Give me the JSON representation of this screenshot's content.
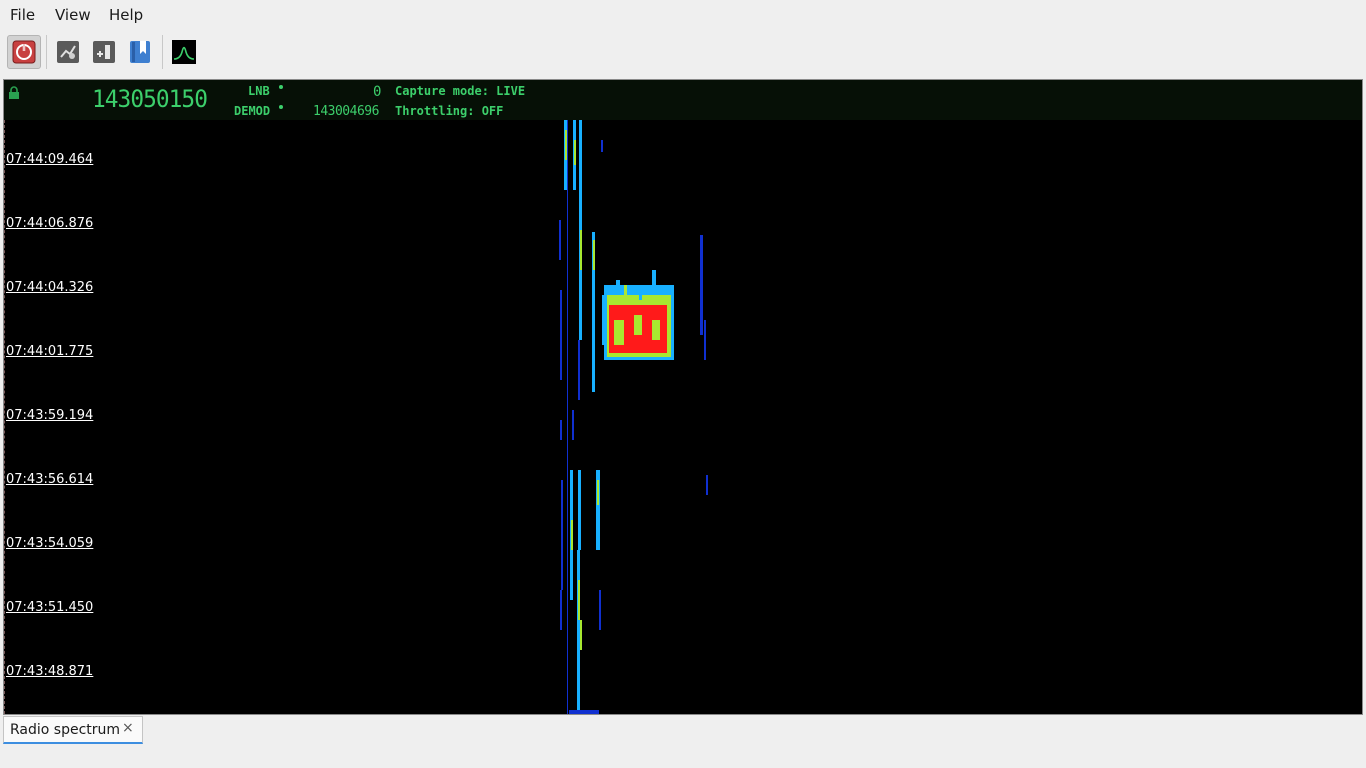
{
  "menu": {
    "items": [
      "File",
      "View",
      "Help"
    ]
  },
  "toolbar": {
    "buttons": [
      {
        "name": "power-button",
        "icon": "power-icon"
      },
      {
        "name": "source-settings-button",
        "icon": "settings-icon"
      },
      {
        "name": "add-marker-button",
        "icon": "add-marker-icon"
      },
      {
        "name": "bookmarks-button",
        "icon": "bookmark-icon"
      },
      {
        "name": "spectrum-button",
        "icon": "spectrum-icon"
      }
    ]
  },
  "header": {
    "main_frequency": "143050150",
    "lnb_label": "LNB",
    "lnb_value": "0",
    "demod_label": "DEMOD",
    "demod_value": "143004696",
    "capture_mode": "Capture mode: LIVE",
    "throttling": "Throttling: OFF"
  },
  "waterfall": {
    "timestamps": [
      "07:44:09.464",
      "07:44:06.876",
      "07:44:04.326",
      "07:44:01.775",
      "07:43:59.194",
      "07:43:56.614",
      "07:43:54.059",
      "07:43:51.450",
      "07:43:48.871"
    ],
    "colors": {
      "low": "#1030d0",
      "mid": "#18b0ff",
      "high": "#a8e830",
      "peak": "#ff1a1a"
    }
  },
  "tabs": [
    {
      "label": "Radio spectrum",
      "close": "×"
    }
  ]
}
